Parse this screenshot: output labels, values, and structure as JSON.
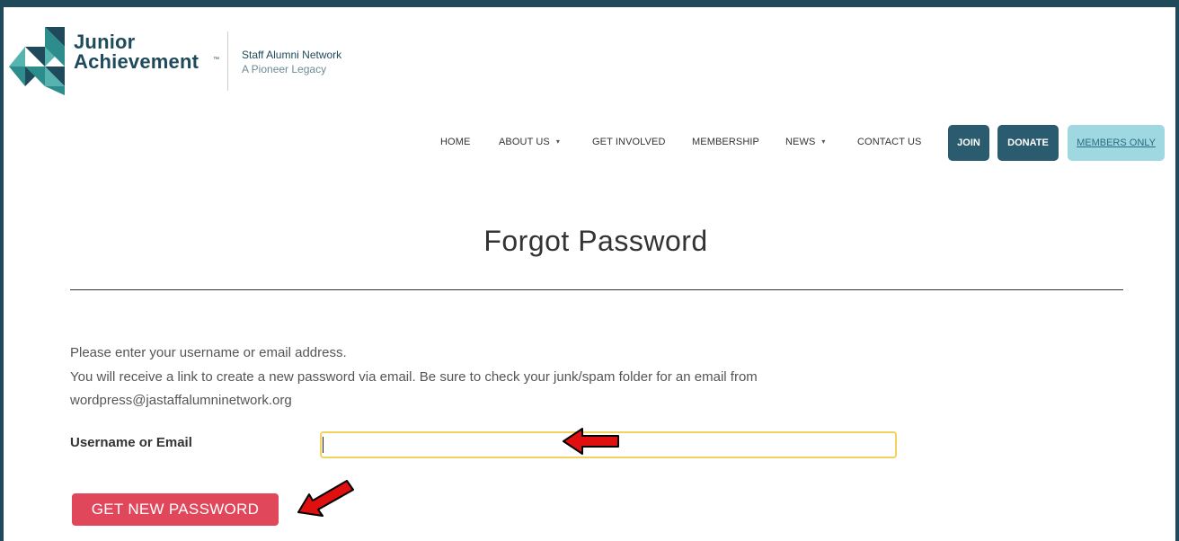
{
  "brand": {
    "line1": "Junior",
    "line2": "Achievement",
    "tm": "™",
    "tagline1": "Staff Alumni Network",
    "tagline2": "A Pioneer Legacy"
  },
  "nav": {
    "items": [
      {
        "label": "HOME",
        "dropdown": false
      },
      {
        "label": "ABOUT US",
        "dropdown": true
      },
      {
        "label": "GET INVOLVED",
        "dropdown": false
      },
      {
        "label": "MEMBERSHIP",
        "dropdown": false
      },
      {
        "label": "NEWS",
        "dropdown": true
      },
      {
        "label": "CONTACT US",
        "dropdown": false
      }
    ],
    "join": "JOIN",
    "donate": "DONATE",
    "members_only": "MEMBERS ONLY",
    "caret": "▾"
  },
  "page": {
    "title": "Forgot Password",
    "instruction1": "Please enter your username or email address.",
    "instruction2": "You will receive a link to create a new password via email. Be sure to check your junk/spam folder for an email from",
    "instruction3": "wordpress@jastaffalumninetwork.org"
  },
  "form": {
    "username_label": "Username or Email",
    "username_value": "",
    "submit": "GET NEW PASSWORD"
  },
  "colors": {
    "brand": "#1f4a5c",
    "nav_button": "#2b5b6e",
    "members_button": "#9fd8e0",
    "submit": "#e0475a",
    "input_border": "#f2d25c",
    "annotation_arrow": "#e01010"
  }
}
